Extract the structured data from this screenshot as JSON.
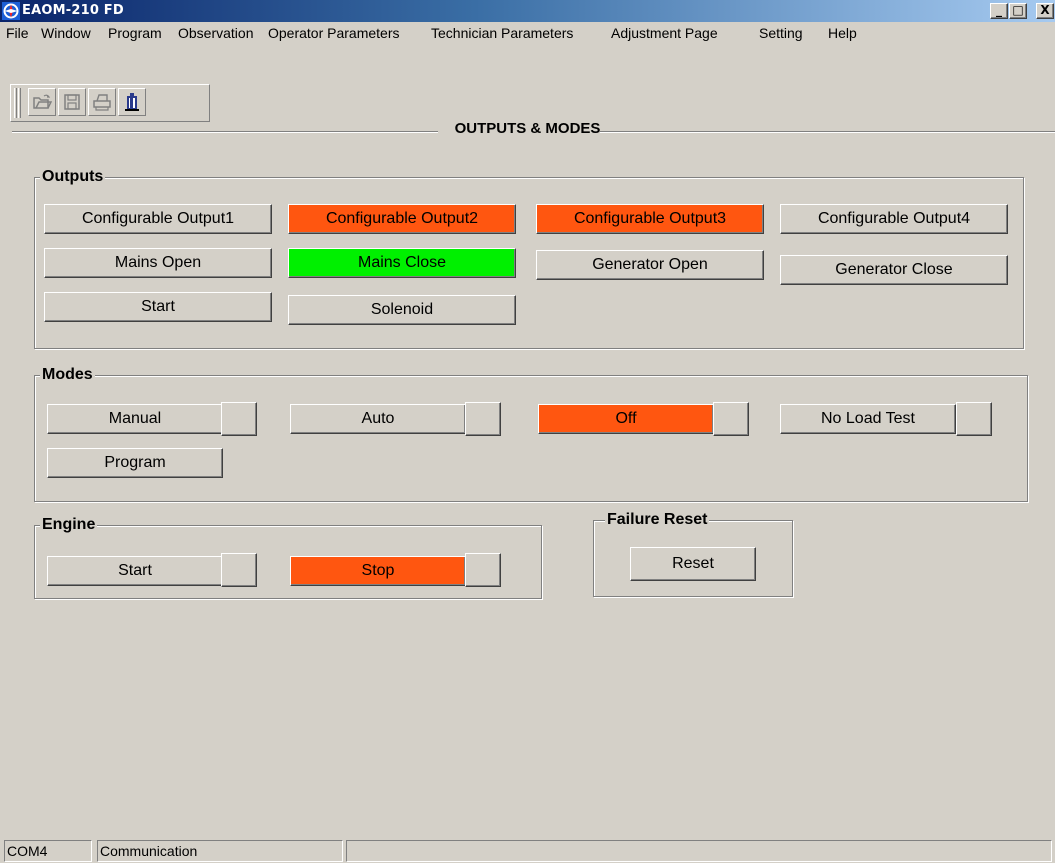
{
  "window": {
    "title": "EAOM-210 FD",
    "minimize_glyph": "_",
    "maximize_glyph": "□",
    "close_glyph": "X"
  },
  "menu": [
    "File",
    "Window",
    "Program",
    "Observation",
    "Operator Parameters",
    "Technician Parameters",
    "Adjustment Page",
    "Setting",
    "Help"
  ],
  "toolbar": {
    "icons": [
      "open-folder-icon",
      "save-disk-icon",
      "print-icon",
      "exit-door-icon"
    ]
  },
  "page": {
    "title": "OUTPUTS & MODES"
  },
  "outputs": {
    "label": "Outputs",
    "buttons": [
      {
        "label": "Configurable Output1",
        "state": "off"
      },
      {
        "label": "Configurable Output2",
        "state": "active-red"
      },
      {
        "label": "Configurable Output3",
        "state": "active-red"
      },
      {
        "label": "Configurable Output4",
        "state": "off"
      },
      {
        "label": "Mains Open",
        "state": "off"
      },
      {
        "label": "Mains Close",
        "state": "active-green"
      },
      {
        "label": "Generator Open",
        "state": "off"
      },
      {
        "label": "Generator Close",
        "state": "off"
      },
      {
        "label": "Start",
        "state": "off"
      },
      {
        "label": "Solenoid",
        "state": "off"
      }
    ]
  },
  "modes": {
    "label": "Modes",
    "buttons": [
      {
        "label": "Manual",
        "state": "off"
      },
      {
        "label": "Auto",
        "state": "off"
      },
      {
        "label": "Off",
        "state": "active-red"
      },
      {
        "label": "No Load Test",
        "state": "off"
      },
      {
        "label": "Program",
        "state": "off"
      }
    ]
  },
  "engine": {
    "label": "Engine",
    "buttons": [
      {
        "label": "Start",
        "state": "off"
      },
      {
        "label": "Stop",
        "state": "active-red"
      }
    ]
  },
  "failure_reset": {
    "label": "Failure Reset",
    "button": "Reset"
  },
  "statusbar": {
    "port": "COM4",
    "status": "Communication",
    "extra": ""
  },
  "colors": {
    "active_red": "#ff5610",
    "active_green": "#00f000",
    "face": "#d4d0c8"
  }
}
